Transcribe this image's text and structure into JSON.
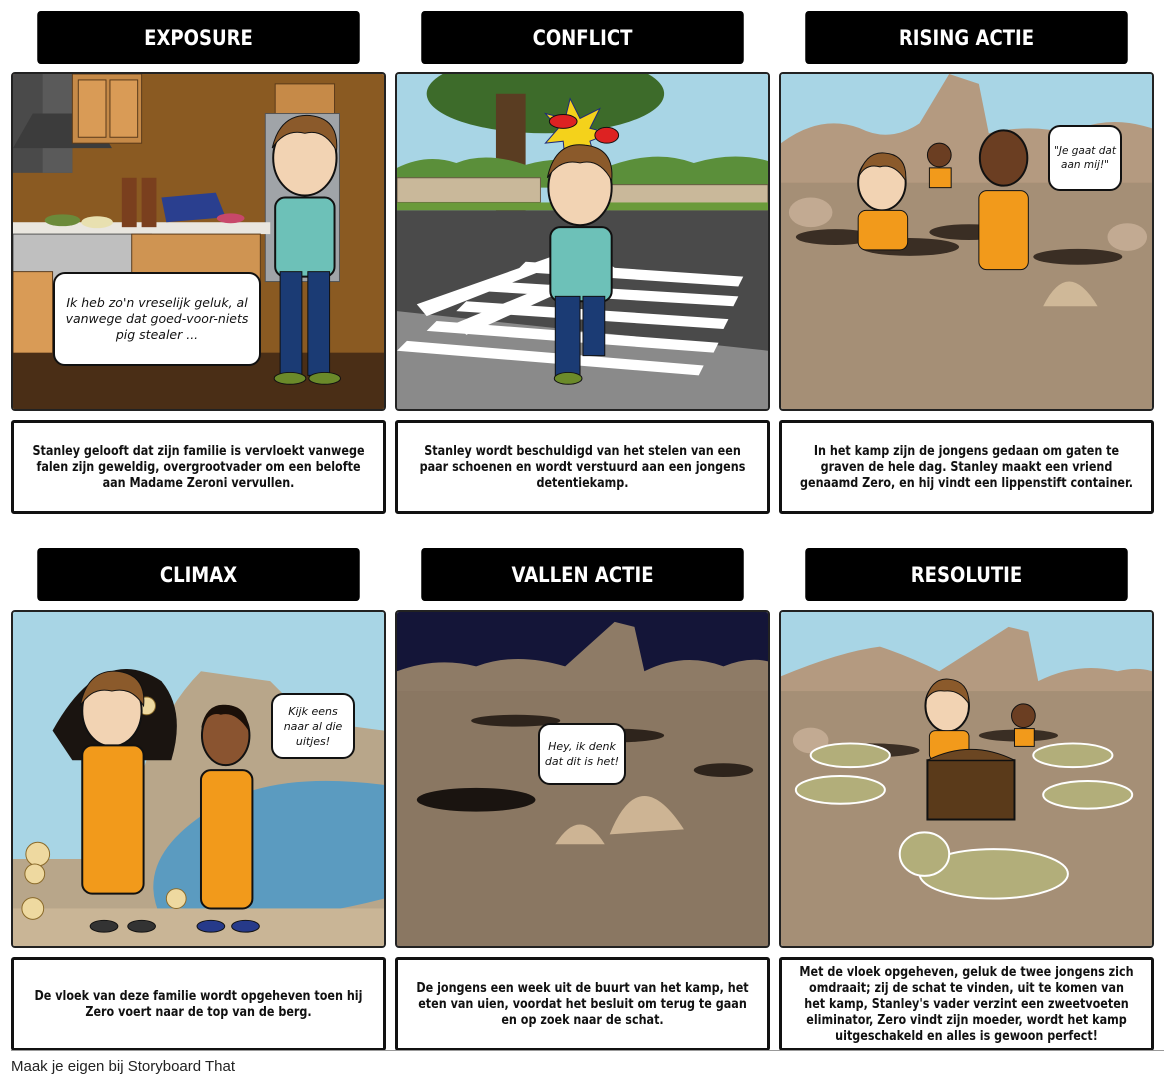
{
  "storyboard": {
    "panels": [
      {
        "title": "Exposure",
        "caption": "Stanley gelooft dat zijn familie is vervloekt vanwege falen zijn geweldig, overgrootvader om een belofte aan Madame Zeroni vervullen.",
        "speech": "Ik heb zo'n vreselijk geluk, al vanwege dat goed-voor-niets pig stealer ...",
        "scene": "kitchen"
      },
      {
        "title": "Conflict",
        "caption": "Stanley wordt beschuldigd van het stelen van een paar schoenen en wordt verstuurd aan een jongens detentiekamp.",
        "speech": "",
        "scene": "street-crosswalk"
      },
      {
        "title": "Rising Actie",
        "caption": "In het kamp zijn de jongens gedaan om gaten te graven de hele dag. Stanley maakt een vriend genaamd Zero, en hij vindt een lippenstift container.",
        "speech": "\"Je gaat dat aan mij!\"",
        "scene": "desert-holes"
      },
      {
        "title": "Climax",
        "caption": "De vloek van deze familie wordt opgeheven toen hij Zero voert naar de top van de berg.",
        "speech": "Kijk eens naar al die uitjes!",
        "scene": "mountain-cave-onions"
      },
      {
        "title": "Vallen Actie",
        "caption": "De jongens een week uit de buurt van het kamp, het eten van uien, voordat het besluit om terug te gaan en op zoek naar de schat.",
        "speech": "Hey, ik denk dat dit is het!",
        "scene": "desert-night"
      },
      {
        "title": "Resolutie",
        "caption": "Met de vloek opgeheven, geluk de twee jongens zich omdraait; zij de schat te vinden, uit te komen van het kamp, Stanley's vader verzint een zweetvoeten eliminator, Zero vindt zijn moeder, wordt het kamp uitgeschakeld en alles is gewoon perfect!",
        "speech": "",
        "scene": "desert-lizards-chest"
      }
    ]
  },
  "footer": {
    "text": "Maak je eigen bij Storyboard That"
  }
}
